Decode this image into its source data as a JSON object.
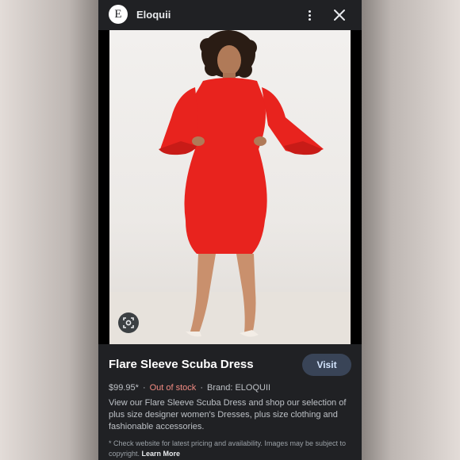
{
  "header": {
    "logo_letter": "E",
    "site_name": "Eloquii",
    "more_icon": "more-vert-icon",
    "close_icon": "close-icon"
  },
  "image": {
    "description_icon": "lens-icon",
    "dress_color": "#e8231e"
  },
  "product": {
    "title": "Flare Sleeve Scuba Dress",
    "visit_label": "Visit",
    "price": "$99.95*",
    "stock_status": "Out of stock",
    "brand": "Brand: ELOQUII",
    "description": "View our Flare Sleeve Scuba Dress and shop our selection of plus size designer women's Dresses, plus size clothing and fashionable accessories.",
    "disclaimer": "* Check website for latest pricing and availability. Images may be subject to copyright.",
    "learn_more": "Learn More"
  }
}
